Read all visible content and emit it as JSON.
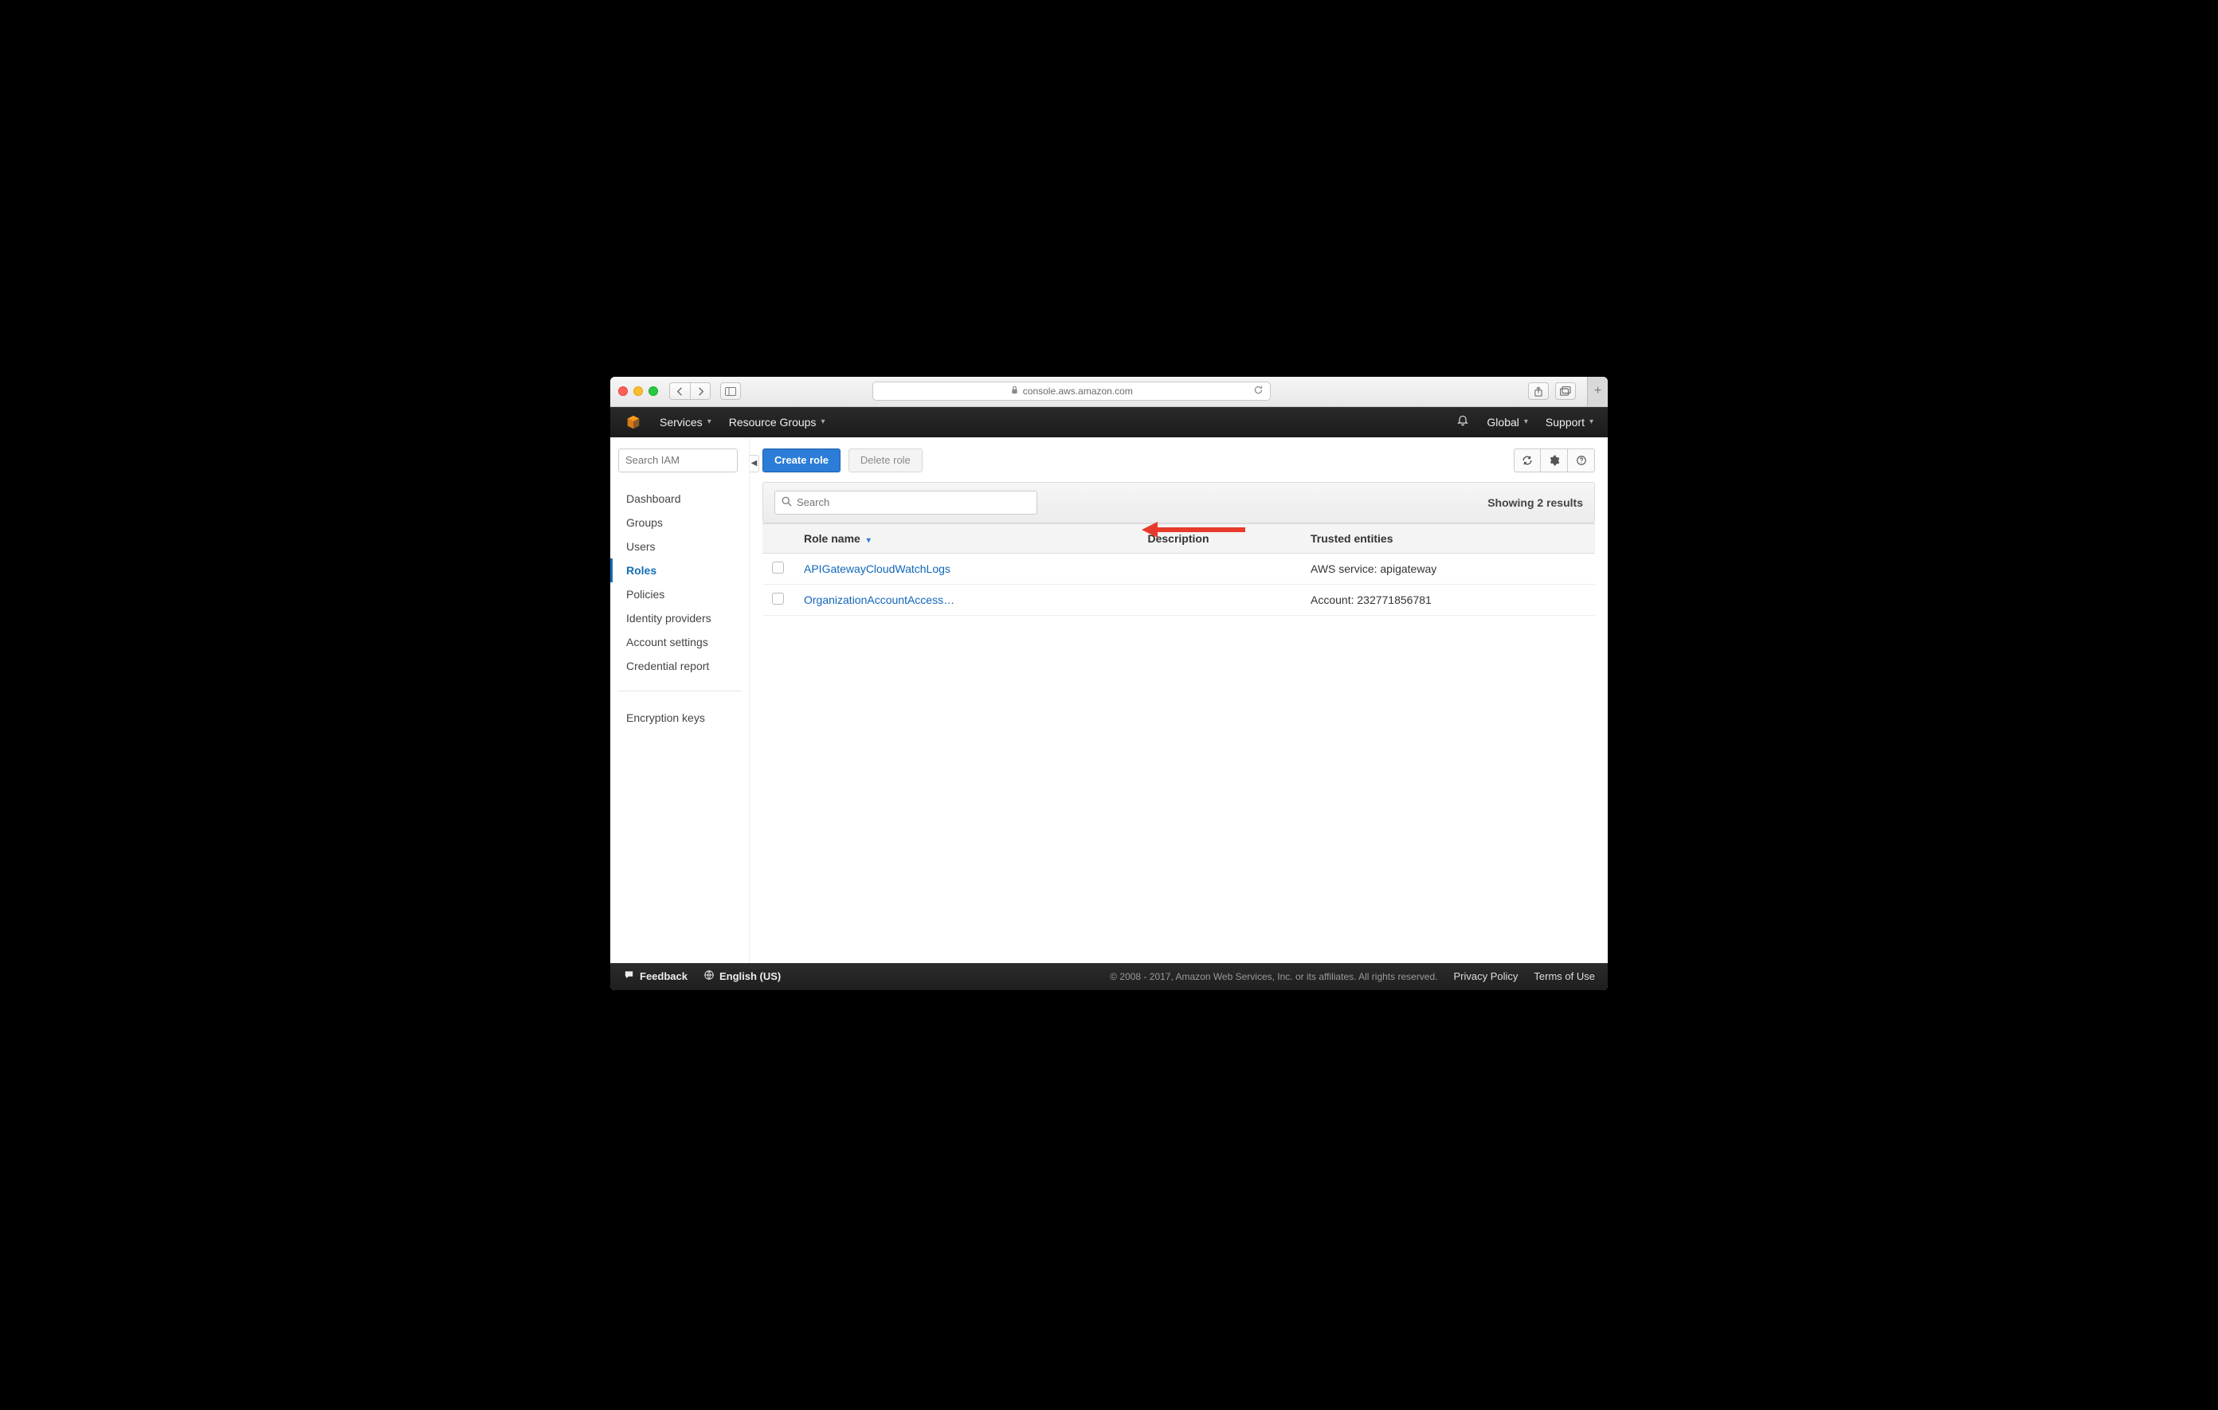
{
  "browser": {
    "url": "console.aws.amazon.com"
  },
  "nav": {
    "services": "Services",
    "resource_groups": "Resource Groups",
    "region": "Global",
    "support": "Support"
  },
  "sidebar": {
    "search_placeholder": "Search IAM",
    "items": [
      "Dashboard",
      "Groups",
      "Users",
      "Roles",
      "Policies",
      "Identity providers",
      "Account settings",
      "Credential report"
    ],
    "active_index": 3,
    "secondary": [
      "Encryption keys"
    ]
  },
  "actions": {
    "create": "Create role",
    "delete": "Delete role"
  },
  "search": {
    "placeholder": "Search",
    "results_label": "Showing 2 results"
  },
  "table": {
    "cols": [
      "Role name",
      "Description",
      "Trusted entities"
    ],
    "rows": [
      {
        "name": "APIGatewayCloudWatchLogs",
        "description": "",
        "trusted": "AWS service: apigateway"
      },
      {
        "name": "OrganizationAccountAccess…",
        "description": "",
        "trusted": "Account: 232771856781"
      }
    ]
  },
  "footer": {
    "feedback": "Feedback",
    "language": "English (US)",
    "copyright": "© 2008 - 2017, Amazon Web Services, Inc. or its affiliates. All rights reserved.",
    "privacy": "Privacy Policy",
    "terms": "Terms of Use"
  }
}
